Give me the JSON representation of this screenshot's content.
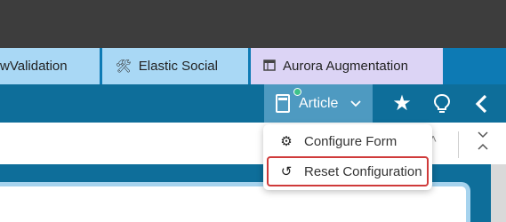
{
  "tabs": [
    {
      "label": "wValidation",
      "icon": ""
    },
    {
      "label": "Elastic Social",
      "icon": "tools-icon"
    },
    {
      "label": "Aurora Augmentation",
      "icon": "window-icon"
    }
  ],
  "toolbar": {
    "doc_type_label": "Article",
    "star_icon": "star-icon",
    "bulb_icon": "lightbulb-icon",
    "back_icon": "chevron-left-icon"
  },
  "menu": {
    "items": [
      {
        "label": "Configure Form",
        "icon": "gear-icon"
      },
      {
        "label": "Reset Configuration",
        "icon": "reset-icon"
      }
    ]
  },
  "colors": {
    "tab_blue": "#a9d8f5",
    "tab_purple": "#dcd4f5",
    "toolbar": "#0e6e9a",
    "highlight": "#cf3a3a"
  }
}
